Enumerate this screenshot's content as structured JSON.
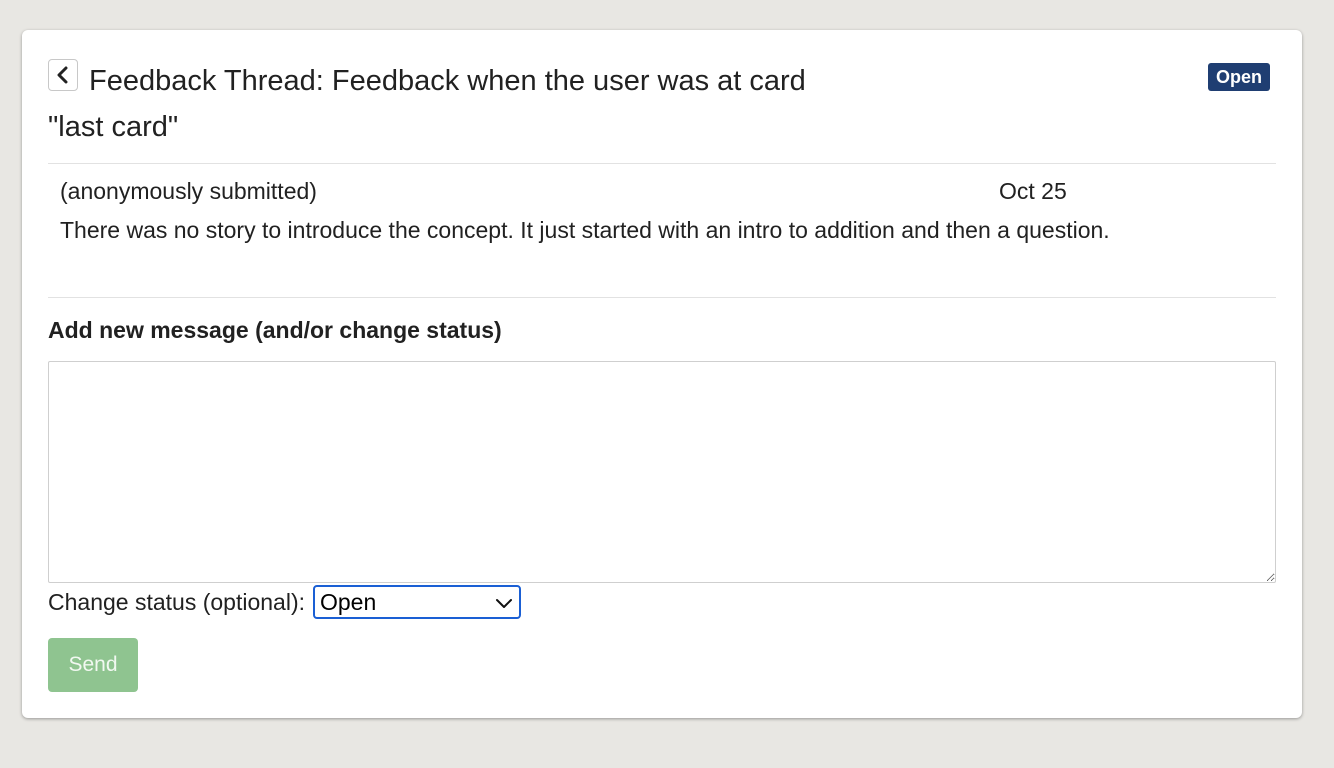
{
  "thread": {
    "title": "Feedback Thread: Feedback when the user was at card \"last card\"",
    "status_badge": "Open",
    "status_badge_color": "#1f3e72"
  },
  "messages": [
    {
      "author": "(anonymously submitted)",
      "date": "Oct 25",
      "text": "There was no story to introduce the concept. It just started with an intro to addition and then a question."
    }
  ],
  "form": {
    "heading": "Add new message (and/or change status)",
    "message_value": "",
    "status_label": "Change status (optional):",
    "status_selected": "Open",
    "send_label": "Send",
    "send_button_color": "#8fc490"
  },
  "icons": {
    "back": "chevron-left-icon",
    "select": "chevron-down-icon"
  }
}
